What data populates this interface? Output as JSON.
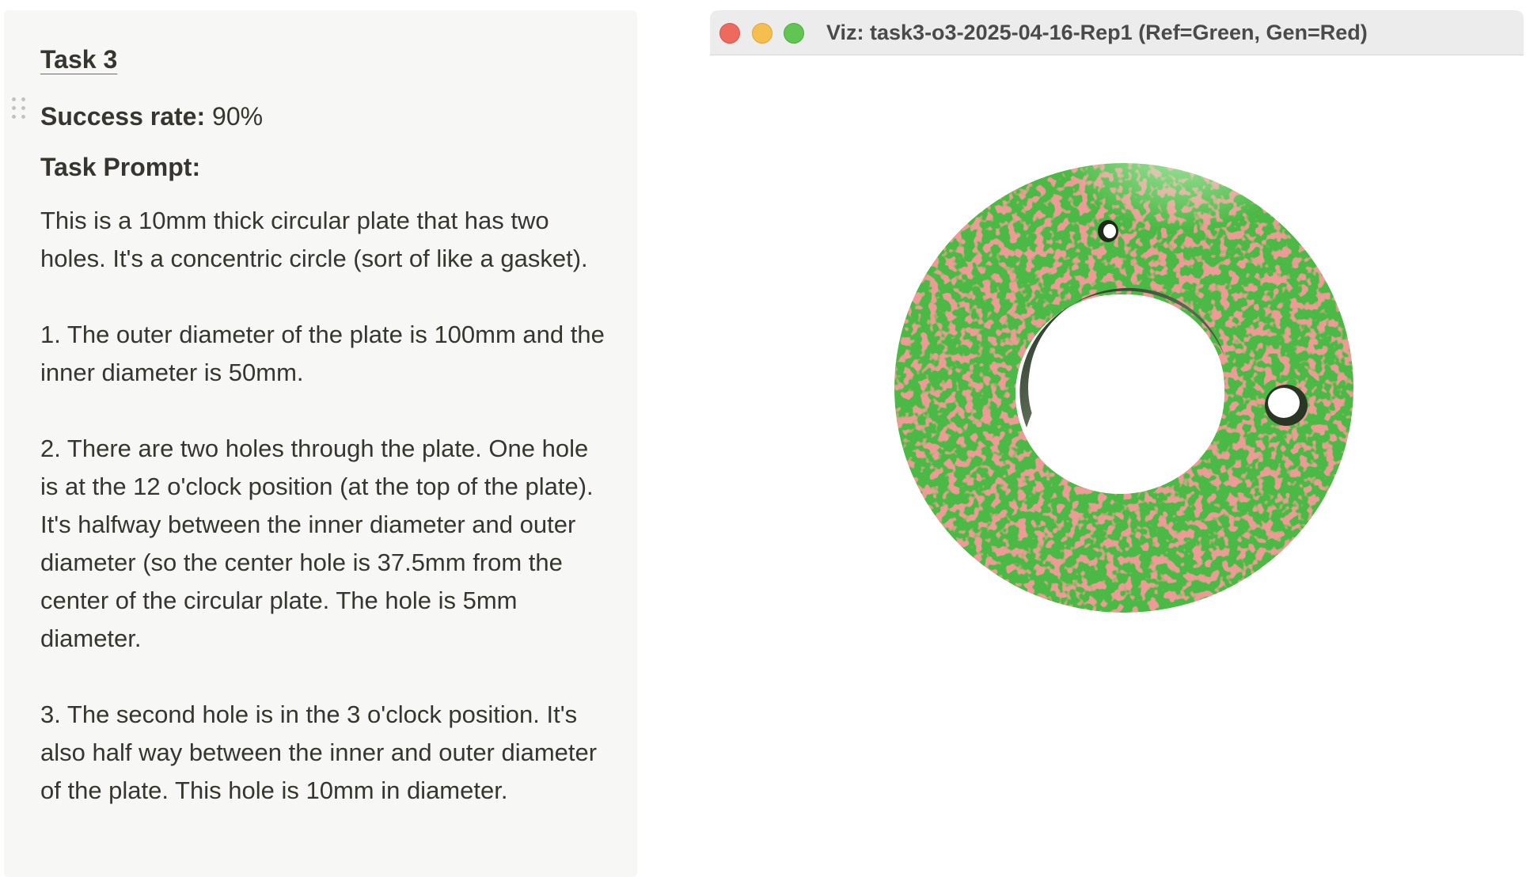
{
  "document": {
    "title": "Task 3",
    "success_label": "Success rate:",
    "success_value": "90%",
    "prompt_heading": "Task Prompt:",
    "paragraphs": [
      "This is a 10mm thick circular plate that has two holes. It's a concentric circle (sort of like a gasket).",
      "1. The outer diameter of the plate is 100mm and the inner diameter is 50mm.",
      "2. There are two holes through the plate. One hole is at the 12 o'clock position (at the top of the plate). It's halfway between the inner diameter and outer diameter (so the center hole is 37.5mm from the center of the circular plate. The hole is 5mm diameter.",
      "3. The second hole is in the 3 o'clock position. It's also half way between the inner and outer diameter of the plate. This hole is 10mm in diameter."
    ]
  },
  "viewer": {
    "window_title": "Viz: task3-o3-2025-04-16-Rep1 (Ref=Green, Gen=Red)",
    "colors": {
      "reference": "#4cb944",
      "generated": "#d9534f"
    },
    "icons": {
      "close": "window-close-icon",
      "minimize": "window-minimize-icon",
      "maximize": "window-maximize-icon"
    }
  }
}
